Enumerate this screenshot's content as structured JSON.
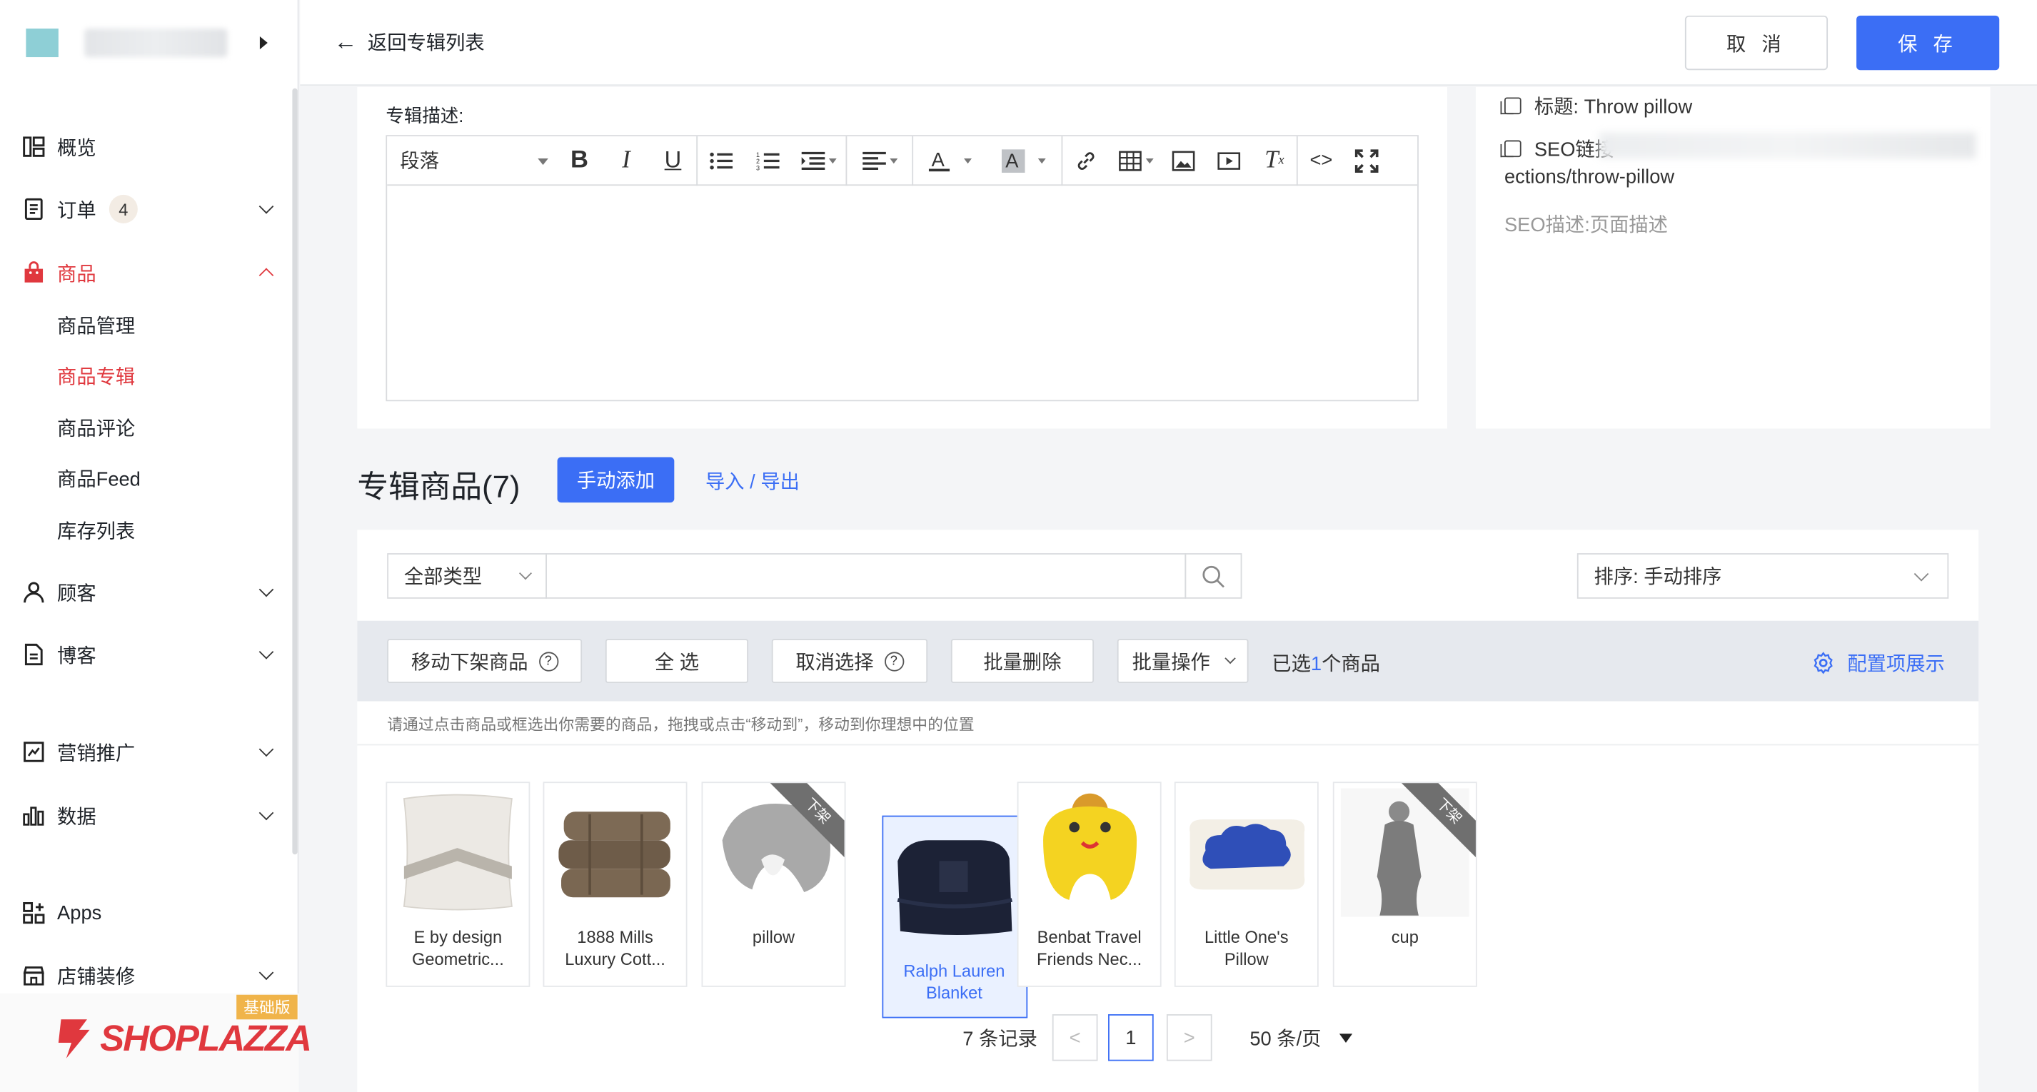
{
  "sidebar": {
    "nav": [
      {
        "label": "概览",
        "icon": "dashboard-icon"
      },
      {
        "label": "订单",
        "icon": "order-icon",
        "badge": "4"
      },
      {
        "label": "商品",
        "icon": "bag-icon",
        "active": true
      },
      {
        "label": "顾客",
        "icon": "user-icon"
      },
      {
        "label": "博客",
        "icon": "blog-icon"
      },
      {
        "label": "营销推广",
        "icon": "marketing-icon"
      },
      {
        "label": "数据",
        "icon": "chart-icon"
      },
      {
        "label": "Apps",
        "icon": "apps-icon"
      },
      {
        "label": "店铺装修",
        "icon": "shop-icon"
      }
    ],
    "product_sub": [
      "商品管理",
      "商品专辑",
      "商品评论",
      "商品Feed",
      "库存列表"
    ],
    "active_sub": "商品专辑",
    "plan_tag": "基础版",
    "brand": "SHOPLAZZA"
  },
  "topbar": {
    "back_label": "返回专辑列表",
    "cancel_label": "取 消",
    "save_label": "保 存"
  },
  "description": {
    "label": "专辑描述:",
    "paragraph_select": "段落"
  },
  "seo": {
    "title_line": "标题: Throw pillow",
    "link_prefix": "SEO链接",
    "link_tail": "ections/throw-pillow",
    "desc_line": "SEO描述:页面描述"
  },
  "products": {
    "title": "专辑商品(7)",
    "add_button": "手动添加",
    "import_export": "导入 / 导出",
    "type_filter": "全部类型",
    "sort": "排序: 手动排序",
    "actions": {
      "move_offshelf": "移动下架商品",
      "select_all": "全 选",
      "deselect": "取消选择",
      "batch_delete": "批量删除",
      "batch_ops": "批量操作",
      "selected_prefix": "已选",
      "selected_count": "1",
      "selected_suffix": "个商品",
      "config": "配置项展示"
    },
    "hint": "请通过点击商品或框选出你需要的商品，拖拽或点击“移动到”，移动到你理想中的位置",
    "offshelf_tag": "下架",
    "items": [
      {
        "name": "E by design Geometric...",
        "offshelf": false,
        "selected": false
      },
      {
        "name": "1888 Mills Luxury Cott...",
        "offshelf": false,
        "selected": false
      },
      {
        "name": "pillow",
        "offshelf": true,
        "selected": false
      },
      {
        "name": "Ralph Lauren Blanket",
        "offshelf": false,
        "selected": true
      },
      {
        "name": "Benbat Travel Friends Nec...",
        "offshelf": false,
        "selected": false
      },
      {
        "name": "Little One's Pillow",
        "offshelf": false,
        "selected": false
      },
      {
        "name": "cup",
        "offshelf": true,
        "selected": false
      }
    ],
    "pagination": {
      "records": "7 条记录",
      "current_page": "1",
      "per_page": "50 条/页"
    }
  }
}
